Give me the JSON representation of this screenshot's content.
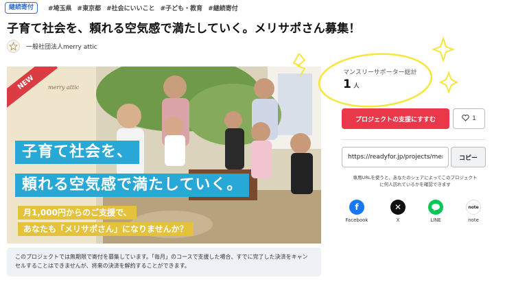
{
  "header": {
    "badge": "継続寄付",
    "tags": [
      "#埼玉県",
      "#東京都",
      "#社会にいいこと",
      "#子ども・教育",
      "#継続寄付"
    ],
    "title": "子育て社会を、頼れる空気感で満たしていく。メリサポさん募集！",
    "org_name": "一般社団法人merry attic"
  },
  "hero": {
    "ribbon": "NEW",
    "brand": "merry attic",
    "headline_1": "子育て社会を、",
    "headline_2": "頼れる空気感で満たしていく。",
    "sub_1": "月1,000円からのご支援で、",
    "sub_2": "あなたも「メリサポさん」になりませんか？"
  },
  "notice": "このプロジェクトでは無期限で寄付を募集しています。「毎月」のコースで支援した場合、すでに完了した決済をキャンセルすることはできませんが、将来の決済を解約することができます。",
  "sidebar": {
    "supporter_label": "マンスリーサポーター総計",
    "supporter_count": "1",
    "supporter_unit": "人",
    "support_button": "プロジェクトの支援にすすむ",
    "favorite_count": "1",
    "share_url": "https://readyfor.jp/projects/merrysupport",
    "copy_button": "コピー",
    "url_note": "専用URLを使うと、あなたのシェアによってこのプロジェクトに何人訪れているかを確認できます",
    "share": [
      {
        "label": "Facebook",
        "icon": "facebook-icon"
      },
      {
        "label": "X",
        "icon": "x-icon"
      },
      {
        "label": "LINE",
        "icon": "line-icon"
      },
      {
        "label": "note",
        "icon": "note-icon"
      }
    ]
  },
  "colors": {
    "accent_red": "#e8384a",
    "headline_blue": "#28a8d6",
    "sub_yellow": "#e4c23c",
    "link_blue": "#2f6fd6",
    "annotation_yellow": "#f5e63a"
  }
}
